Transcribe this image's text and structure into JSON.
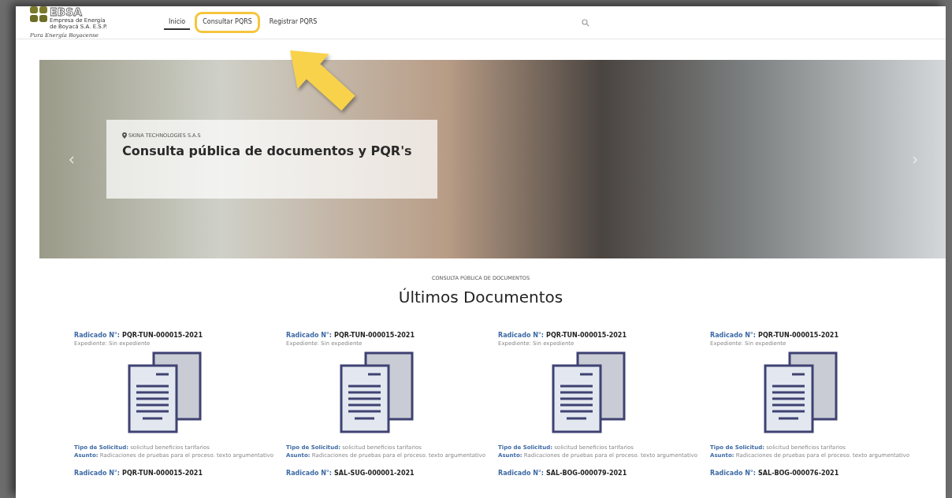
{
  "logo": {
    "name": "EBSA",
    "lines": [
      "Empresa de Energía",
      "de Boyacá S.A. E.S.P."
    ],
    "slogan": "Pura Energía Boyacense"
  },
  "nav": {
    "tabs": [
      {
        "label": "Inicio",
        "selected": true,
        "highlighted": false
      },
      {
        "label": "Consultar PQRS",
        "selected": false,
        "highlighted": true
      },
      {
        "label": "Registrar PQRS",
        "selected": false,
        "highlighted": false
      }
    ]
  },
  "hero": {
    "location": "SKINA TECHNOLOGIES S.A.S",
    "title": "Consulta pública de documentos y PQR's"
  },
  "section": {
    "eyebrow": "CONSULTA PÚBLICA DE DOCUMENTOS",
    "heading": "Últimos Documentos"
  },
  "documents": [
    {
      "label": "Radicado N°:",
      "number": "PQR-TUN-000015-2021",
      "expediente": "Expediente: Sin expediente",
      "tipo_label": "Tipo de Solicitud:",
      "tipo": "solicitud beneficios tarifarios",
      "asunto_label": "Asunto:",
      "asunto": "Radicaciones de pruebas para el proceso. texto argumentativo"
    },
    {
      "label": "Radicado N°:",
      "number": "PQR-TUN-000015-2021",
      "expediente": "Expediente: Sin expediente",
      "tipo_label": "Tipo de Solicitud:",
      "tipo": "solicitud beneficios tarifarios",
      "asunto_label": "Asunto:",
      "asunto": "Radicaciones de pruebas para el proceso. texto argumentativo"
    },
    {
      "label": "Radicado N°:",
      "number": "PQR-TUN-000015-2021",
      "expediente": "Expediente: Sin expediente",
      "tipo_label": "Tipo de Solicitud:",
      "tipo": "solicitud beneficios tarifarios",
      "asunto_label": "Asunto:",
      "asunto": "Radicaciones de pruebas para el proceso. texto argumentativo"
    },
    {
      "label": "Radicado N°:",
      "number": "PQR-TUN-000015-2021",
      "expediente": "Expediente: Sin expediente",
      "tipo_label": "Tipo de Solicitud:",
      "tipo": "solicitud beneficios tarifarios",
      "asunto_label": "Asunto:",
      "asunto": "Radicaciones de pruebas para el proceso. texto argumentativo"
    },
    {
      "label": "Radicado N°:",
      "number": "PQR-TUN-000015-2021"
    },
    {
      "label": "Radicado N°:",
      "number": "SAL-SUG-000001-2021"
    },
    {
      "label": "Radicado N°:",
      "number": "SAL-BOG-000079-2021"
    },
    {
      "label": "Radicado N°:",
      "number": "SAL-BOG-000076-2021"
    }
  ]
}
